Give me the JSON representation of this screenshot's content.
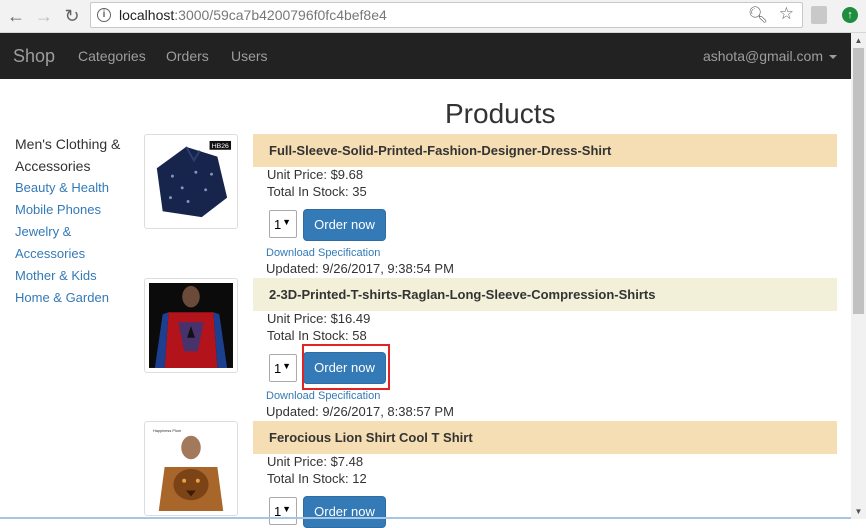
{
  "browser": {
    "url_host": "localhost",
    "url_rest": ":3000/59ca7b4200796f0fc4bef8e4"
  },
  "navbar": {
    "brand": "Shop",
    "links": [
      "Categories",
      "Orders",
      "Users"
    ],
    "user": "ashota@gmail.com"
  },
  "page": {
    "title": "Products"
  },
  "categories": {
    "active": "Men's Clothing & Accessories",
    "links": [
      "Beauty & Health",
      "Mobile Phones",
      "Jewelry &",
      "Accessories",
      "Mother & Kids",
      "Home & Garden"
    ]
  },
  "products": [
    {
      "name": "Full-Sleeve-Solid-Printed-Fashion-Designer-Dress-Shirt",
      "price": "Unit Price: $9.68",
      "stock": "Total In Stock: 35",
      "qty": "1",
      "order_label": "Order now",
      "download_label": "Download Specification",
      "updated": "Updated: 9/26/2017, 9:38:54 PM"
    },
    {
      "name": "2-3D-Printed-T-shirts-Raglan-Long-Sleeve-Compression-Shirts",
      "price": "Unit Price: $16.49",
      "stock": "Total In Stock: 58",
      "qty": "1",
      "order_label": "Order now",
      "download_label": "Download Specification",
      "updated": "Updated: 9/26/2017, 8:38:57 PM"
    },
    {
      "name": "Ferocious Lion Shirt Cool T Shirt",
      "price": "Unit Price: $7.48",
      "stock": "Total In Stock: 12",
      "qty": "1",
      "order_label": "Order now"
    }
  ],
  "thumbnail_labels": [
    "HB26",
    "Happiness Plum"
  ]
}
